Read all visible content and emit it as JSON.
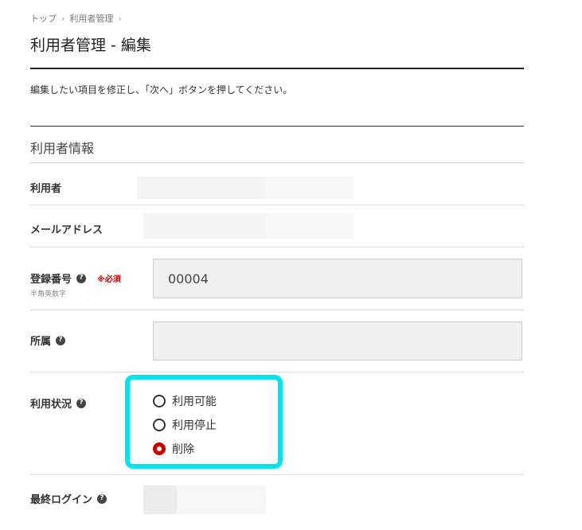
{
  "breadcrumb": {
    "items": [
      "トップ",
      "利用者管理"
    ],
    "separator": "›"
  },
  "page": {
    "title": "利用者管理 - 編集",
    "instruction": "編集したい項目を修正し、「次へ」ボタンを押してください。"
  },
  "section": {
    "title": "利用者情報"
  },
  "fields": {
    "user": {
      "label": "利用者"
    },
    "email": {
      "label": "メールアドレス"
    },
    "reg_number": {
      "label": "登録番号",
      "required": "※必須",
      "hint": "半角英数字",
      "value": "00004",
      "help_icon": "question-circle-icon"
    },
    "affiliation": {
      "label": "所属",
      "value": "",
      "help_icon": "question-circle-icon"
    },
    "status": {
      "label": "利用状況",
      "help_icon": "question-circle-icon",
      "options": [
        {
          "label": "利用可能",
          "checked": false
        },
        {
          "label": "利用停止",
          "checked": false
        },
        {
          "label": "削除",
          "checked": true
        }
      ]
    },
    "last_login": {
      "label": "最終ログイン",
      "help_icon": "question-circle-icon"
    }
  },
  "colors": {
    "accent_red": "#cc0000",
    "highlight": "#00e5ee",
    "help_icon": "#444444"
  }
}
